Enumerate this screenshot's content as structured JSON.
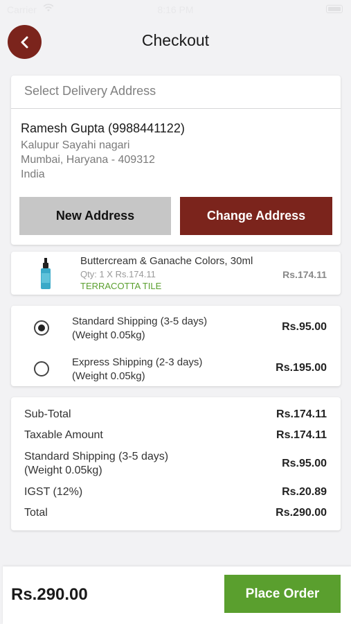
{
  "status_bar": {
    "carrier": "Carrier",
    "time": "8:16 PM"
  },
  "header": {
    "title": "Checkout"
  },
  "address": {
    "header": "Select Delivery Address",
    "name": "Ramesh Gupta (9988441122)",
    "line1": "Kalupur Sayahi nagari",
    "line2": "Mumbai, Haryana - 409312",
    "country": "India",
    "new_button": "New Address",
    "change_button": "Change Address"
  },
  "product": {
    "name": "Buttercream & Ganache Colors, 30ml",
    "qty": "Qty: 1 X Rs.174.11",
    "variant": "TERRACOTTA TILE",
    "price": "Rs.174.11"
  },
  "shipping": [
    {
      "label1": "Standard Shipping (3-5 days)",
      "label2": "(Weight 0.05kg)",
      "price": "Rs.95.00",
      "selected": true
    },
    {
      "label1": "Express Shipping (2-3 days)",
      "label2": "(Weight 0.05kg)",
      "price": "Rs.195.00",
      "selected": false
    }
  ],
  "summary": [
    {
      "label": "Sub-Total",
      "value": "Rs.174.11"
    },
    {
      "label": "Taxable Amount",
      "value": "Rs.174.11"
    },
    {
      "label": "Standard Shipping (3-5 days)  (Weight 0.05kg)",
      "value": "Rs.95.00"
    },
    {
      "label": "IGST (12%)",
      "value": "Rs.20.89"
    },
    {
      "label": "Total",
      "value": "Rs.290.00"
    }
  ],
  "footer": {
    "total": "Rs.290.00",
    "place_order": "Place Order"
  },
  "colors": {
    "primary": "#7b241c",
    "accent_green": "#5a9f2e",
    "background": "#f2f2f4"
  }
}
